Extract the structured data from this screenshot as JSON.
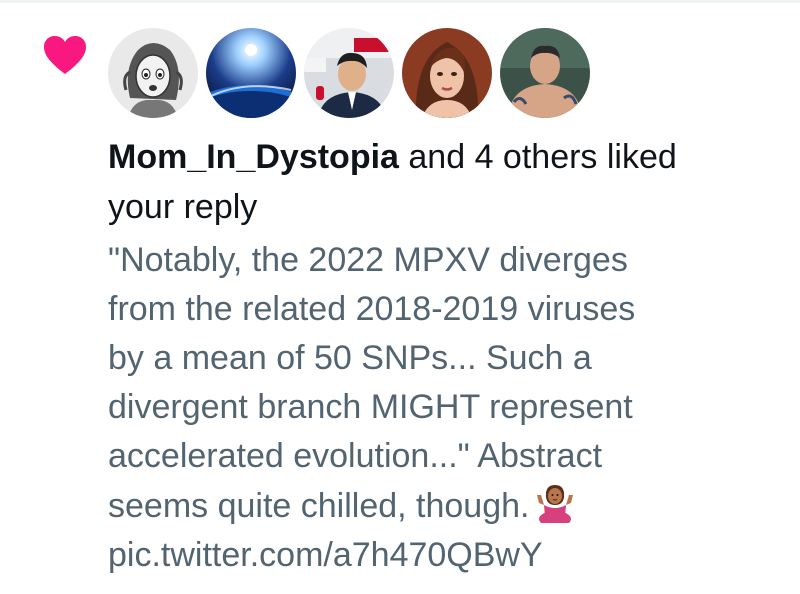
{
  "notification": {
    "type": "like",
    "icon": "heart-icon",
    "accent_color": "#f91880",
    "avatars": [
      {
        "name": "avatar-cartoon-woman"
      },
      {
        "name": "avatar-space-earth"
      },
      {
        "name": "avatar-news-anchor"
      },
      {
        "name": "avatar-woman-photo"
      },
      {
        "name": "avatar-man-photo"
      }
    ],
    "liked_user": "Mom_In_Dystopia",
    "liked_rest": " and 4 others liked",
    "liked_line2": "your reply"
  },
  "reply": {
    "lines": [
      "\"Notably, the 2022 MPXV diverges",
      "from the related 2018-2019 viruses",
      "by a mean of 50 SNPs... Such a",
      "divergent branch MIGHT represent",
      "accelerated evolution...\" Abstract",
      "seems quite chilled, though.",
      "pic.twitter.com/a7h470QBwY"
    ],
    "emoji": "shrug-emoji"
  },
  "colors": {
    "primary_text": "#0f1419",
    "secondary_text": "#536471"
  }
}
